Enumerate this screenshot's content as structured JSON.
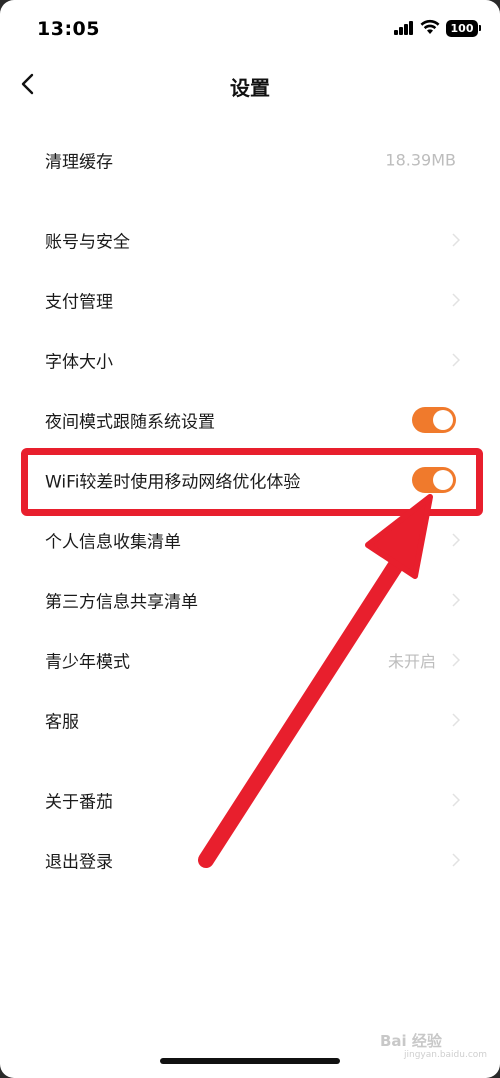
{
  "status_bar": {
    "time": "13:05",
    "battery": "100"
  },
  "header": {
    "title": "设置"
  },
  "rows": [
    {
      "label": "清理缓存",
      "value": "18.39MB",
      "control": "value"
    },
    {
      "label": "账号与安全",
      "control": "chevron"
    },
    {
      "label": "支付管理",
      "control": "chevron"
    },
    {
      "label": "字体大小",
      "control": "chevron"
    },
    {
      "label": "夜间模式跟随系统设置",
      "control": "toggle",
      "on": true
    },
    {
      "label": "WiFi较差时使用移动网络优化体验",
      "control": "toggle",
      "on": true
    },
    {
      "label": "个人信息收集清单",
      "control": "chevron"
    },
    {
      "label": "第三方信息共享清单",
      "control": "chevron"
    },
    {
      "label": "青少年模式",
      "value": "未开启",
      "control": "value-chevron"
    },
    {
      "label": "客服",
      "control": "chevron"
    },
    {
      "label": "关于番茄",
      "control": "chevron"
    },
    {
      "label": "退出登录",
      "control": "chevron"
    }
  ],
  "watermark": {
    "text": "Bai 经验",
    "sub": "jingyan.baidu.com"
  },
  "colors": {
    "toggle_on": "#f07a2c",
    "annotation": "#e81f2d"
  }
}
